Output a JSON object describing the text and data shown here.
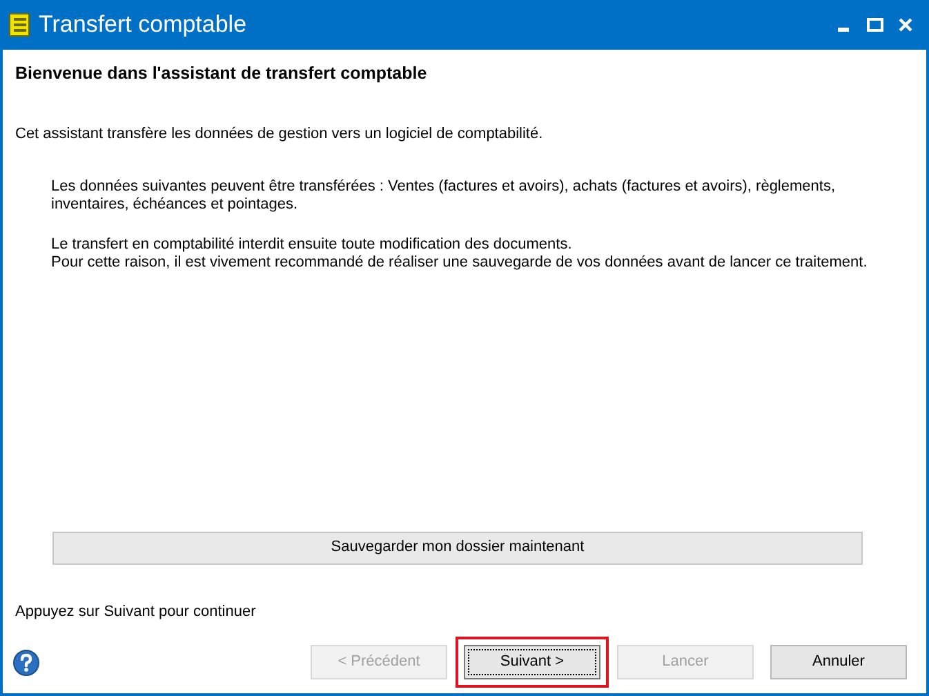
{
  "window": {
    "title": "Transfert comptable"
  },
  "heading": "Bienvenue dans l'assistant de transfert comptable",
  "intro": "Cet assistant transfère les données de gestion vers un logiciel de comptabilité.",
  "paragraphs": [
    [
      "Les données suivantes peuvent être transférées : Ventes (factures et avoirs), achats (factures et avoirs), règlements, inventaires, échéances et pointages."
    ],
    [
      "Le transfert en comptabilité interdit ensuite toute modification des documents.",
      "Pour cette raison, il est vivement recommandé de réaliser une sauvegarde de vos données avant de lancer ce traitement."
    ]
  ],
  "backup_button": "Sauvegarder mon dossier maintenant",
  "footer_hint": "Appuyez sur Suivant pour continuer",
  "buttons": [
    {
      "label": "< Précédent",
      "disabled": true,
      "focused": false,
      "highlighted": false
    },
    {
      "label": "Suivant >",
      "disabled": false,
      "focused": true,
      "highlighted": true
    },
    {
      "label": "Lancer",
      "disabled": true,
      "focused": false,
      "highlighted": false
    },
    {
      "label": "Annuler",
      "disabled": false,
      "focused": false,
      "highlighted": false
    }
  ]
}
